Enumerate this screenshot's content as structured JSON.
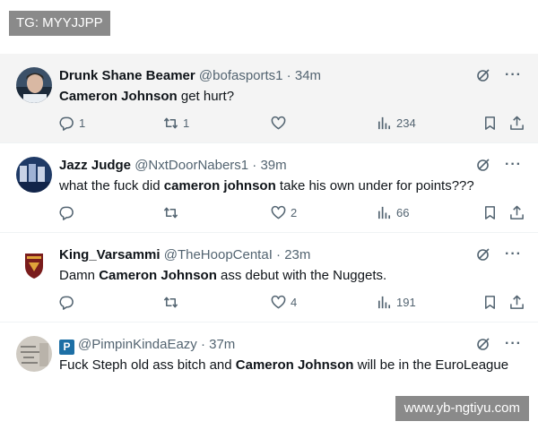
{
  "watermarks": {
    "top": "TG: MYYJJPP",
    "bottom": "www.yb-ngtiyu.com"
  },
  "tweets": [
    {
      "name": "Drunk Shane Beamer",
      "meta": "@bofasports1 · 34m",
      "text_parts": [
        "",
        "Cameron Johnson",
        " get hurt?"
      ],
      "reply_count": "1",
      "retweet_count": "1",
      "like_count": "",
      "view_count": "234"
    },
    {
      "name": "Jazz Judge",
      "meta": "@NxtDoorNabers1 · 39m",
      "text_parts": [
        "what the fuck did ",
        "cameron johnson",
        " take his own under for points???"
      ],
      "reply_count": "",
      "retweet_count": "",
      "like_count": "2",
      "view_count": "66"
    },
    {
      "name": "King_Varsammi",
      "meta": "@TheHoopCentaI · 23m",
      "text_parts": [
        "Damn ",
        "Cameron Johnson",
        " ass debut with the Nuggets."
      ],
      "reply_count": "",
      "retweet_count": "",
      "like_count": "4",
      "view_count": "191"
    },
    {
      "name": "",
      "badge": "P",
      "meta": "@PimpinKindaEazy · 37m",
      "text_parts": [
        "Fuck Steph old ass bitch and ",
        "Cameron Johnson",
        " will be in the EuroLeague"
      ]
    }
  ],
  "colors": {
    "text": "#0f1419",
    "muted": "#536471",
    "highlight_bg": "#f4f4f4",
    "watermark_bg": "#8a8a8a"
  },
  "icons": [
    "grok-icon",
    "more-icon",
    "reply-icon",
    "retweet-icon",
    "like-icon",
    "views-icon",
    "bookmark-icon",
    "share-icon"
  ]
}
